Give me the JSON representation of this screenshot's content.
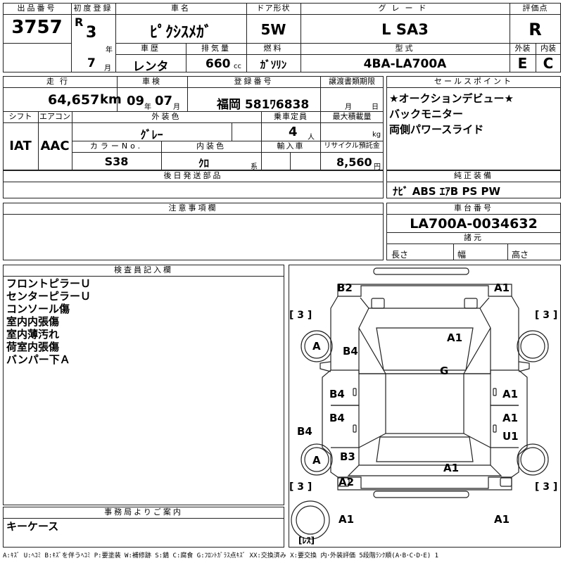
{
  "header": {
    "lot_label": "出品番号",
    "lot_number": "3757",
    "first_reg_label": "初度登録",
    "era": "R",
    "year": "3",
    "year_unit": "年",
    "month": "7",
    "month_unit": "月",
    "car_name_label": "車名",
    "car_name": "ﾋﾟｸｼｽﾒｶﾞ",
    "door_label": "ドア形状",
    "door": "5W",
    "grade_label": "グレード",
    "grade": "L SA3",
    "score_label": "評価点",
    "score": "R",
    "history_label": "車歴",
    "history": "レンタ",
    "displacement_label": "排気量",
    "displacement": "660",
    "displacement_unit": "cc",
    "fuel_label": "燃料",
    "fuel": "ｶﾞｿﾘﾝ",
    "model_label": "型式",
    "model": "4BA-LA700A",
    "exterior_label": "外装",
    "exterior": "E",
    "interior_label": "内装",
    "interior": "C"
  },
  "specs": {
    "mileage_label": "走行",
    "mileage": "64,657",
    "mileage_unit": "km",
    "inspection_label": "車検",
    "insp_year": "09",
    "insp_year_unit": "年",
    "insp_month": "07",
    "insp_month_unit": "月",
    "reg_label": "登録番号",
    "reg_number": "福岡 581ﾜ6838",
    "transfer_label": "譲渡書類期限",
    "transfer_month_unit": "月",
    "transfer_day_unit": "日",
    "shift_label": "シフト",
    "shift": "IAT",
    "ac_label": "エアコン",
    "ac": "AAC",
    "color_label": "外装色",
    "color": "ｸﾞﾚｰ",
    "capacity_label": "乗車定員",
    "capacity": "4",
    "capacity_unit": "人",
    "max_load_label": "最大積載量",
    "max_load_unit": "kg",
    "color_no_label": "カラーNo.",
    "color_no": "S38",
    "interior_color_label": "内装色",
    "interior_color": "ｸﾛ",
    "interior_color_unit": "系",
    "import_label": "輸入車",
    "recycle_label": "リサイクル預託金",
    "recycle": "8,560",
    "recycle_unit": "円",
    "later_parts_label": "後日発送部品",
    "notes_label": "注意事項欄"
  },
  "selling_points": {
    "label": "セールスポイント",
    "items": [
      "★オークションデビュー★",
      "バックモニター",
      "両側パワースライド"
    ]
  },
  "equipment": {
    "label": "純正装備",
    "value": "ﾅﾋﾞ ABS ｴｱB PS PW"
  },
  "chassis": {
    "label": "車台番号",
    "value": "LA700A-0034632",
    "spec_label": "諸元",
    "length_label": "長さ",
    "width_label": "幅",
    "height_label": "高さ"
  },
  "inspector": {
    "label": "検査員記入欄",
    "lines": [
      "フロントピラーＵ",
      "センターピラーＵ",
      "コンソール傷",
      "室内内張傷",
      "室内薄汚れ",
      "荷室内張傷",
      "バンパー下Ａ"
    ]
  },
  "office": {
    "label": "事務局よりご案内",
    "text": "キーケース"
  },
  "diagram": {
    "tire_fl": "[ 3 ]",
    "tire_fr": "[ 3 ]",
    "tire_rl": "[ 3 ]",
    "tire_rr": "[ 3 ]",
    "b2": "B2",
    "a1_top_right": "A1",
    "wheel_fl": "A",
    "b4_fl": "B4",
    "a1_hood": "A1",
    "g_roof": "G",
    "b4_fdoor_l": "B4",
    "a1_fdoor_r": "A1",
    "b4_rdoor_l": "B4",
    "a1_rdoor_r": "A1",
    "u1_rdoor_r": "U1",
    "b4_sill_l": "B4",
    "wheel_rl": "A",
    "b3": "B3",
    "a1_rear": "A1",
    "a2": "A2",
    "a1_bottom_left": "A1",
    "a1_bottom_right": "A1",
    "spare": "[ﾚｽ]"
  },
  "legend": "A:ｷｽﾞ U:ﾍｺﾐ B:ｷｽﾞを伴うﾍｺﾐ P:要塗装 W:補修跡 S:錆 C:腐食 G:ﾌﾛﾝﾄｶﾞﾗｽ点ｷｽﾞ XX:交換済み X:要交換 内･外装評価 5段階ﾗﾝｸ順(A･B･C･D･E) 1"
}
